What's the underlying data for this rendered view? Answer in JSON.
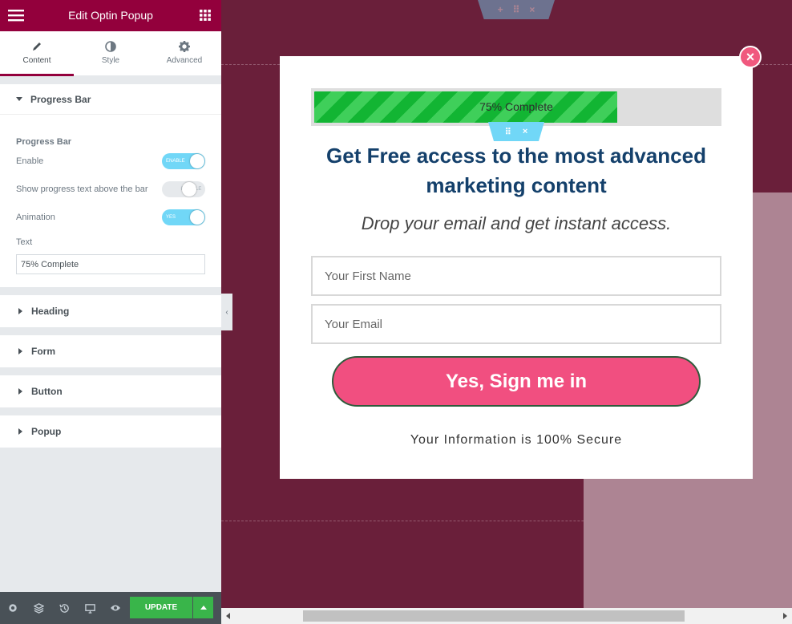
{
  "panel": {
    "title": "Edit Optin Popup",
    "tabs": [
      {
        "label": "Content",
        "icon": "pencil-icon"
      },
      {
        "label": "Style",
        "icon": "contrast-icon"
      },
      {
        "label": "Advanced",
        "icon": "gear-icon"
      }
    ],
    "progress_section": {
      "header": "Progress Bar",
      "subtitle": "Progress Bar",
      "enable_label": "Enable",
      "enable_state": "ENABLE",
      "show_text_label": "Show progress text above the bar",
      "show_text_state": "DISABLE",
      "animation_label": "Animation",
      "animation_state": "YES",
      "text_label": "Text",
      "text_value": "75% Complete"
    },
    "sections": [
      "Heading",
      "Form",
      "Button",
      "Popup"
    ],
    "update_label": "UPDATE"
  },
  "popup": {
    "progress_text": "75% Complete",
    "progress_value": 0.75,
    "heading": "Get Free access to the most advanced marketing content",
    "subheading": "Drop your email and get instant access.",
    "first_name_placeholder": "Your First Name",
    "email_placeholder": "Your Email",
    "button_label": "Yes, Sign me in",
    "secure_text": "Your Information is 100% Secure",
    "close_symbol": "×"
  },
  "colors": {
    "brand": "#93003c",
    "accent": "#71d7f7",
    "progress": "#12b533",
    "button": "#f14f80",
    "heading": "#14406b",
    "update": "#39b54a"
  }
}
